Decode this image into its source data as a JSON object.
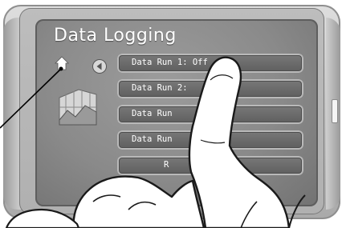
{
  "screen": {
    "title": "Data Logging",
    "menu": [
      {
        "label": "Data Run 1: Off"
      },
      {
        "label": "Data Run 2: "
      },
      {
        "label": "Data Run "
      },
      {
        "label": "Data Run"
      },
      {
        "label": "R"
      }
    ]
  },
  "icons": {
    "home": "home-icon",
    "back": "back-arrow-icon",
    "graphic": "data-logging-chart-icon"
  },
  "colors": {
    "screen_bg": "#8a8a8a",
    "menu_button": "#666666",
    "text": "#ffffff",
    "device_body": "#c2c2c2"
  }
}
